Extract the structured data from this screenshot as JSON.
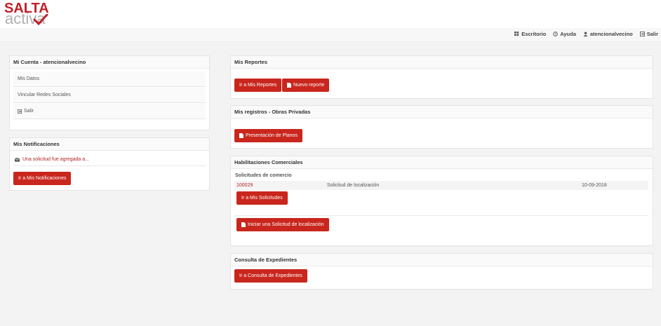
{
  "brand": {
    "line1": "SALTA",
    "line2": "activa",
    "red": "#c0202a",
    "grey": "#b0b0b0"
  },
  "topnav": {
    "escritorio": "Escritorio",
    "ayuda": "Ayuda",
    "user": "atencionalvecino",
    "salir": "Salir"
  },
  "cuenta": {
    "title": "Mi Cuenta - atencionalvecino",
    "items": [
      "Mis Datos",
      "Vincular Redes Sociales",
      "Salir"
    ]
  },
  "notificaciones": {
    "title": "Mis Notificaciones",
    "item": "Una solicitud fue agregada a...",
    "button": "Ir a Mis Notificaciones"
  },
  "reportes": {
    "title": "Mis Reportes",
    "btn_ir": "Ir a Mis Reportes",
    "btn_nuevo": "Nuevo reporte"
  },
  "registros": {
    "title": "Mis registros - Obras Privadas",
    "btn": "Presentación de Planos"
  },
  "habilitaciones": {
    "title": "Habilitaciones Comerciales",
    "subtitle": "Solicitudes de comercio",
    "row": {
      "id": "100029",
      "desc": "Solicitud de localización",
      "date": "10-09-2018"
    },
    "btn_ir": "Ir a Mis Solicitudes",
    "btn_iniciar": "Iniciar una Solicitud de localización"
  },
  "expedientes": {
    "title": "Consulta de Expedientes",
    "btn": "Ir a Consulta de Expedientes"
  },
  "colors": {
    "accent": "#c9261d",
    "background": "#f3f3f3"
  }
}
